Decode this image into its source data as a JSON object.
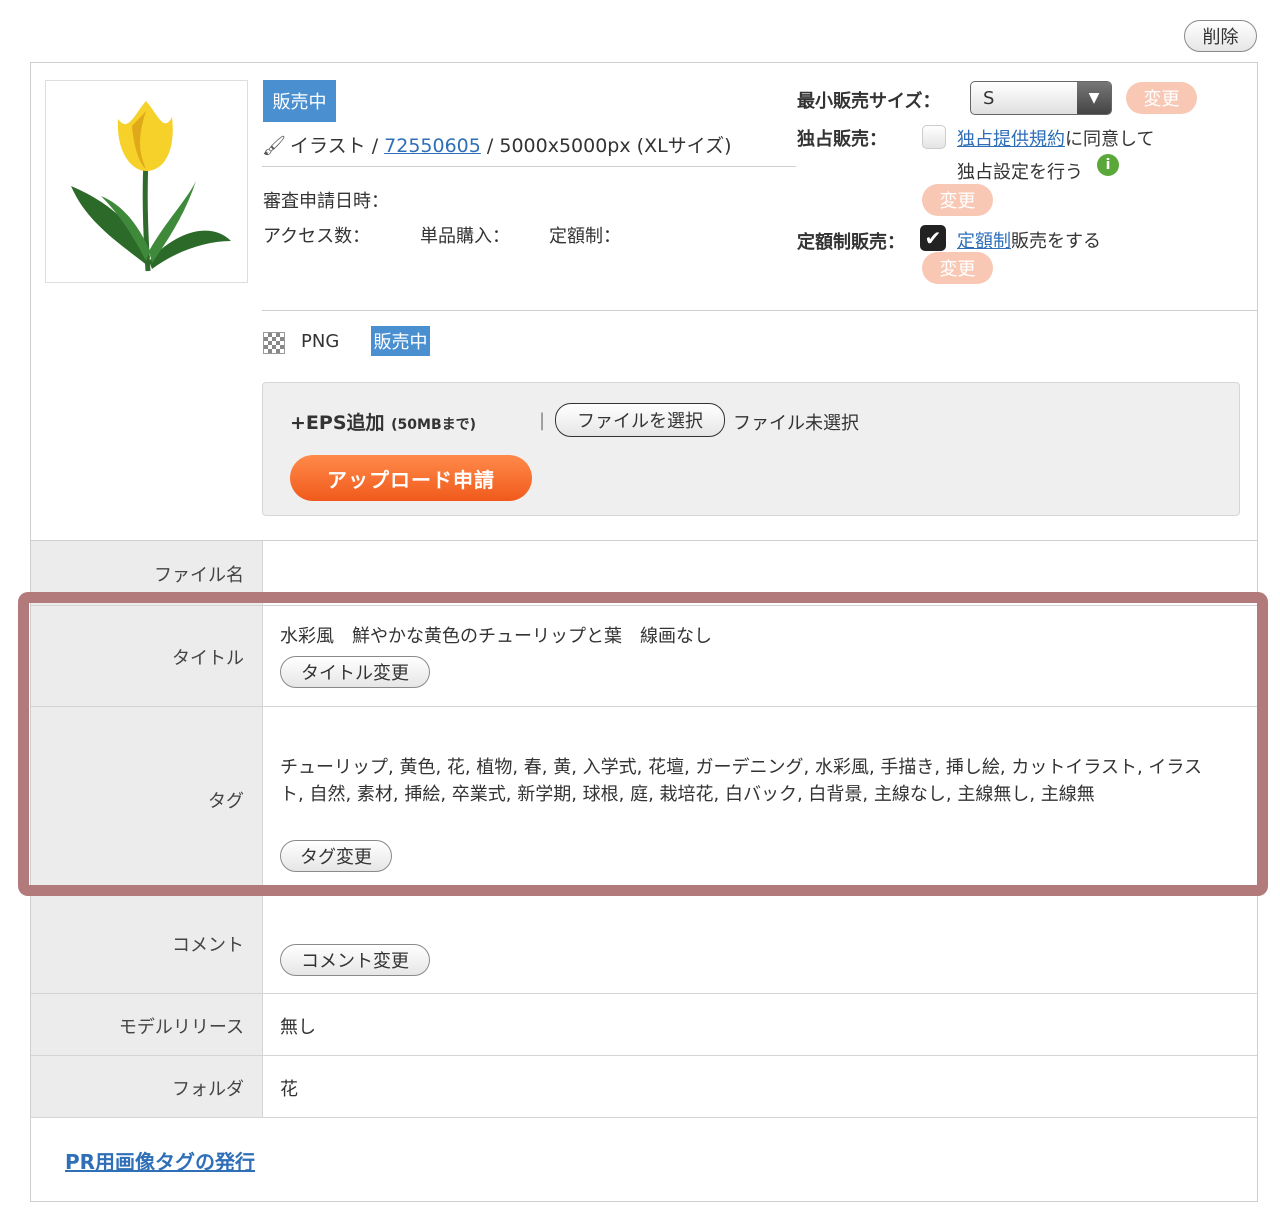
{
  "top": {
    "delete_label": "削除"
  },
  "item": {
    "status_badge": "販売中",
    "type_label": "イラスト / ",
    "id_link": "72550605",
    "size_info": " / 5000x5000px (XLサイズ)",
    "review_date_label": "審査申請日時：",
    "access_label": "アクセス数：",
    "single_purchase_label": "単品購入：",
    "subscription_label": "定額制："
  },
  "sales": {
    "min_size_label": "最小販売サイズ：",
    "min_size_value": "S",
    "change_label": "変更",
    "exclusive_label": "独占販売：",
    "exclusive_link": "独占提供規約",
    "exclusive_text1": "に同意して",
    "exclusive_text2": "独占設定を行う",
    "subscription_sale_label": "定額制販売：",
    "subscription_link": "定額制",
    "subscription_text": "販売をする"
  },
  "file": {
    "format": "PNG",
    "status_badge": "販売中",
    "eps_add": "+EPS追加",
    "eps_limit": "(50MBまで)",
    "separator": "|",
    "choose_file": "ファイルを選択",
    "no_file": "ファイル未選択",
    "upload_button": "アップロード申請"
  },
  "rows": {
    "filename_label": "ファイル名",
    "title_label": "タイトル",
    "title_value": "水彩風　鮮やかな黄色のチューリップと葉　線画なし",
    "title_button": "タイトル変更",
    "tag_label": "タグ",
    "tag_line1": "チューリップ, 黄色, 花, 植物, 春, 黄, 入学式, 花壇, ガーデニング, 水彩風, 手描き, 挿し絵, カットイラスト, イラス",
    "tag_line2": "ト, 自然, 素材, 挿絵, 卒業式, 新学期, 球根, 庭, 栽培花, 白バック, 白背景, 主線なし, 主線無し, 主線無",
    "tag_button": "タグ変更",
    "comment_label": "コメント",
    "comment_button": "コメント変更",
    "model_label": "モデルリリース",
    "model_value": "無し",
    "folder_label": "フォルダ",
    "folder_value": "花"
  },
  "footer": {
    "pr_link": "PR用画像タグの発行"
  },
  "colors": {
    "badge": "#4a90d0",
    "peach": "#f8c8b4",
    "upload": "#f05a1c",
    "highlight": "#b27a7a",
    "link": "#2e6fb8"
  }
}
